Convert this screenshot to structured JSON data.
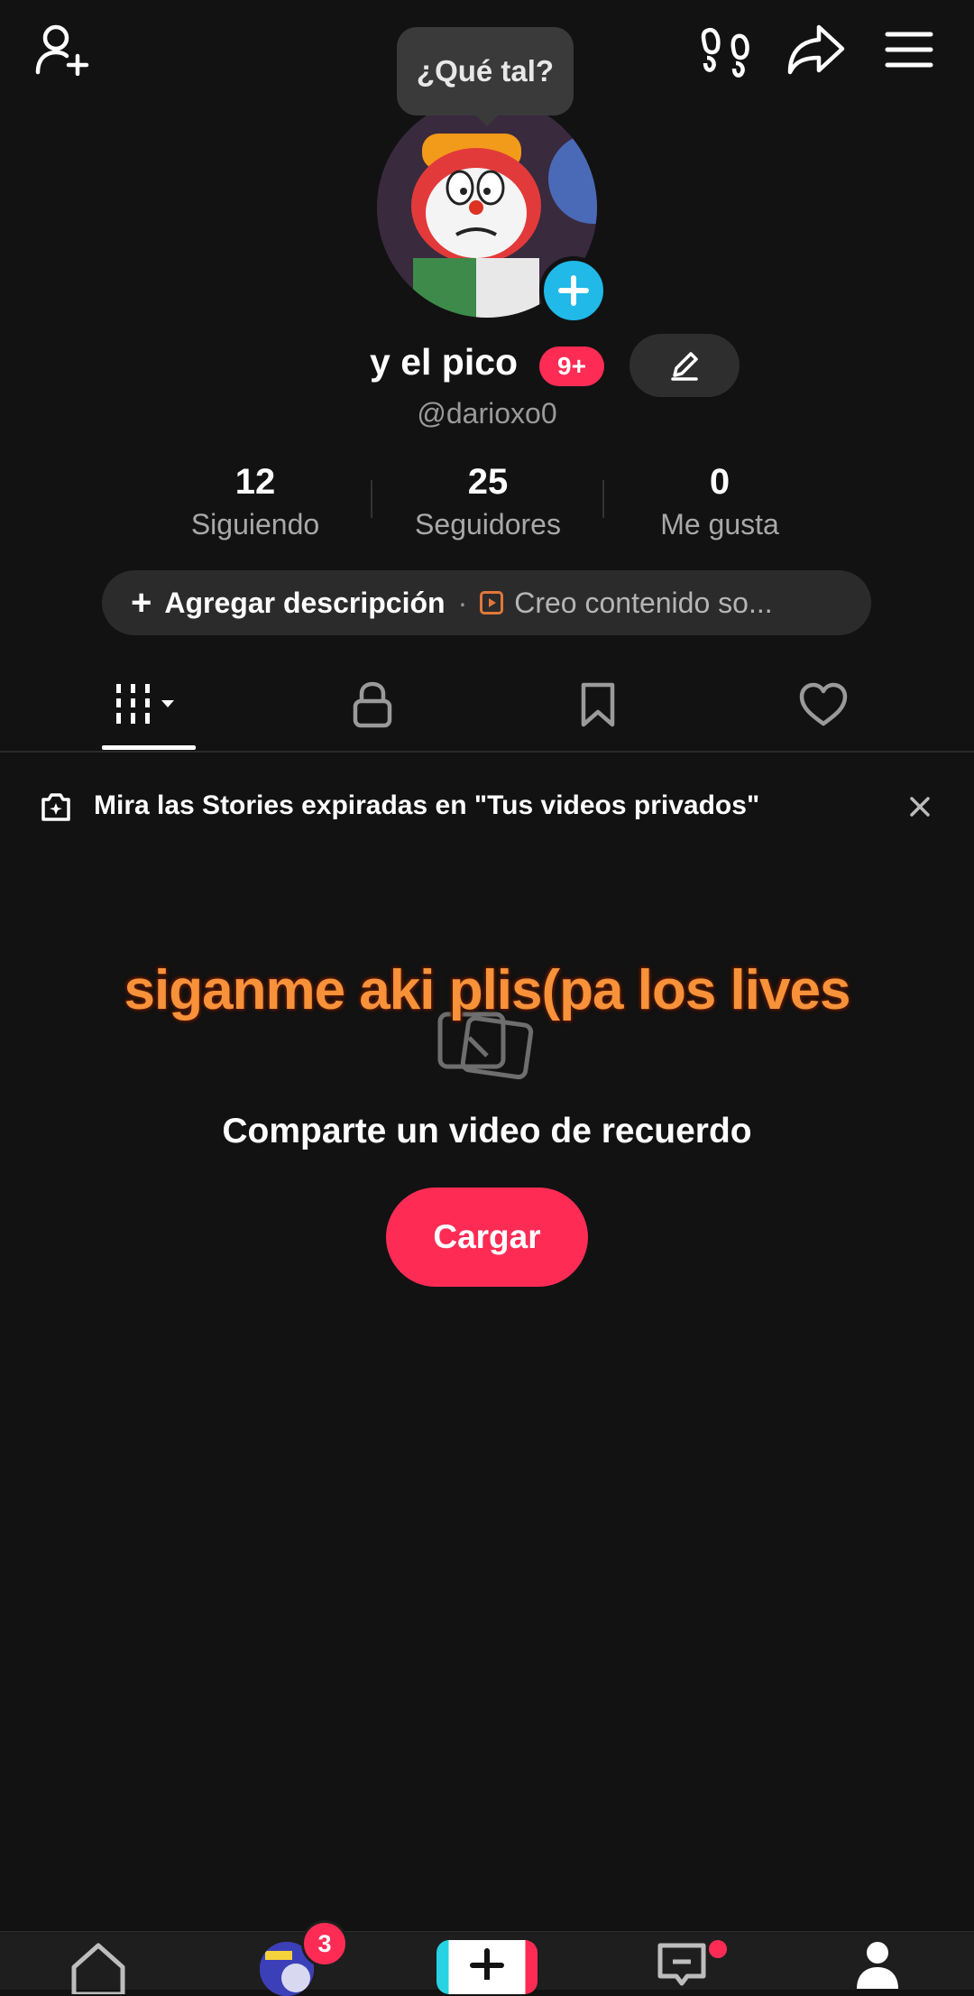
{
  "tooltip": "¿Qué tal?",
  "profile": {
    "display_name": "y el pico",
    "notification_badge": "9+",
    "username": "@darioxo0"
  },
  "stats": {
    "following": {
      "value": "12",
      "label": "Siguiendo"
    },
    "followers": {
      "value": "25",
      "label": "Seguidores"
    },
    "likes": {
      "value": "0",
      "label": "Me gusta"
    }
  },
  "bio": {
    "add_description": "Agregar descripción",
    "separator": "·",
    "creator_text": "Creo contenido so..."
  },
  "tabs": [
    {
      "name": "videos-grid",
      "icon": "grid-icon"
    },
    {
      "name": "private",
      "icon": "lock-icon"
    },
    {
      "name": "saved",
      "icon": "bookmark-icon"
    },
    {
      "name": "liked",
      "icon": "heart-icon"
    }
  ],
  "stories_banner": "Mira las Stories expiradas en \"Tus videos privados\"",
  "overlay_caption": "siganme aki plis(pa los lives",
  "empty_state": {
    "title": "Comparte un video de recuerdo",
    "button": "Cargar"
  },
  "bottom_nav": {
    "inbox_badge_count": "3"
  },
  "colors": {
    "background": "#121212",
    "accent": "#fe2c55",
    "plus_blue": "#20b9e8",
    "overlay_orange": "#f7923a"
  }
}
